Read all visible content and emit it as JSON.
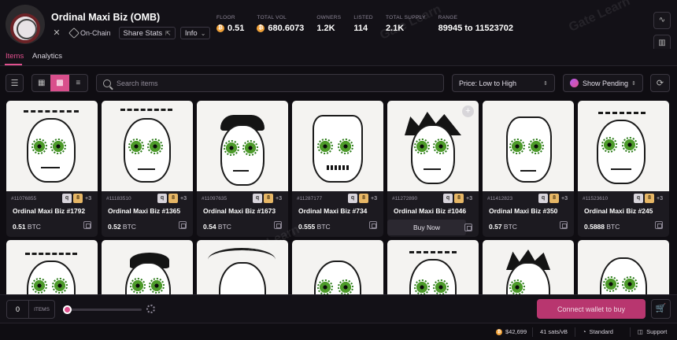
{
  "collection": {
    "title": "Ordinal Maxi Biz (OMB)",
    "onchain_label": "On-Chain",
    "share_label": "Share Stats",
    "info_label": "Info"
  },
  "stats": [
    {
      "label": "FLOOR",
      "value": "0.51",
      "btc": true
    },
    {
      "label": "TOTAL VOL",
      "value": "680.6073",
      "btc": true
    },
    {
      "label": "OWNERS",
      "value": "1.2K",
      "btc": false
    },
    {
      "label": "LISTED",
      "value": "114",
      "btc": false
    },
    {
      "label": "TOTAL SUPPLY",
      "value": "2.1K",
      "btc": false
    },
    {
      "label": "RANGE",
      "value": "89945 to 11523702",
      "btc": false
    }
  ],
  "tabs": [
    {
      "label": "Items",
      "active": true
    },
    {
      "label": "Analytics",
      "active": false
    }
  ],
  "toolbar": {
    "search_placeholder": "Search items",
    "sort_value": "Price: Low to High",
    "pending_label": "Show Pending"
  },
  "cards": [
    {
      "inscription": "#11076855",
      "name": "Ordinal Maxi Biz #1792",
      "price": "0.51",
      "unit": "BTC",
      "more": "+3"
    },
    {
      "inscription": "#11183510",
      "name": "Ordinal Maxi Biz #1365",
      "price": "0.52",
      "unit": "BTC",
      "more": "+3"
    },
    {
      "inscription": "#11097635",
      "name": "Ordinal Maxi Biz #1673",
      "price": "0.54",
      "unit": "BTC",
      "more": "+3"
    },
    {
      "inscription": "#11287177",
      "name": "Ordinal Maxi Biz #734",
      "price": "0.555",
      "unit": "BTC",
      "more": "+3"
    },
    {
      "inscription": "#11272890",
      "name": "Ordinal Maxi Biz #1046",
      "price": "",
      "unit": "",
      "more": "+3",
      "buy_label": "Buy Now"
    },
    {
      "inscription": "#11412823",
      "name": "Ordinal Maxi Biz #350",
      "price": "0.57",
      "unit": "BTC",
      "more": "+3"
    },
    {
      "inscription": "#11523610",
      "name": "Ordinal Maxi Biz #245",
      "price": "0.5888",
      "unit": "BTC",
      "more": "+3"
    }
  ],
  "badge_letters": {
    "silver": "q",
    "gold": "8"
  },
  "bottom": {
    "qty_value": "0",
    "qty_unit": "ITEMS",
    "connect_label": "Connect wallet to buy"
  },
  "status": {
    "btc_price": "$42,699",
    "fee": "41 sats/vB",
    "speed": "Standard",
    "support": "Support"
  },
  "watermark_text": "Gate Learn",
  "colors": {
    "accent": "#e0508e",
    "btc": "#f2a33a",
    "connect": "#b8366f"
  }
}
